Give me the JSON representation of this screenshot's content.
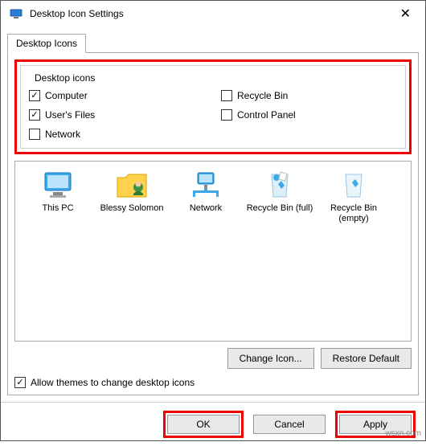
{
  "window": {
    "title": "Desktop Icon Settings"
  },
  "tab": {
    "label": "Desktop Icons"
  },
  "fieldset": {
    "legend": "Desktop icons",
    "items": {
      "computer": {
        "label": "Computer",
        "checked": true
      },
      "users_files": {
        "label": "User's Files",
        "checked": true
      },
      "network": {
        "label": "Network",
        "checked": false
      },
      "recycle_bin": {
        "label": "Recycle Bin",
        "checked": false
      },
      "control_panel": {
        "label": "Control Panel",
        "checked": false
      }
    }
  },
  "preview": {
    "this_pc": "This PC",
    "user": "Blessy Solomon",
    "network": "Network",
    "bin_full": "Recycle Bin (full)",
    "bin_empty": "Recycle Bin (empty)"
  },
  "buttons": {
    "change_icon": "Change Icon...",
    "restore_default": "Restore Default",
    "ok": "OK",
    "cancel": "Cancel",
    "apply": "Apply"
  },
  "allow_themes": {
    "label": "Allow themes to change desktop icons",
    "checked": true
  },
  "watermark": "wsxn.com"
}
